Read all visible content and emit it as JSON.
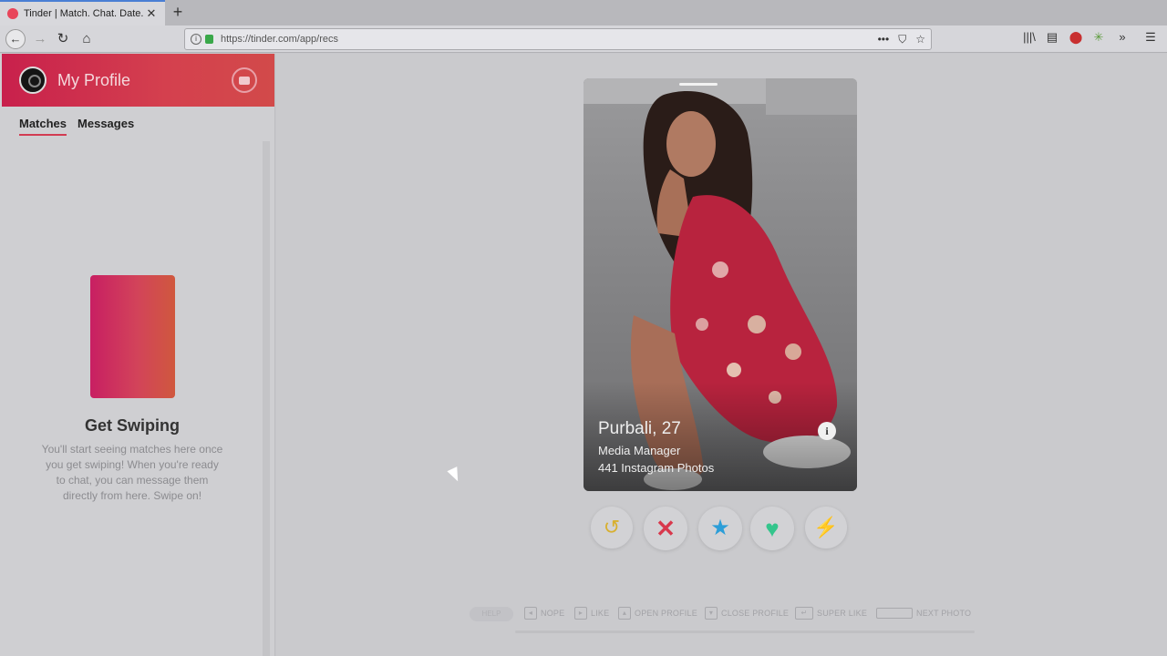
{
  "browser": {
    "tab_title": "Tinder | Match. Chat. Date.",
    "tab_close": "✕",
    "new_tab": "+",
    "url": "https://tinder.com/app/recs",
    "nav": {
      "back": "←",
      "forward": "→",
      "reload": "↻",
      "home": "⌂"
    },
    "url_actions": [
      "•••",
      "⛉",
      "☆"
    ],
    "toolbar_icons": [
      "|||\\",
      "▤",
      "⬤",
      "✳",
      "»",
      "☰"
    ],
    "icon_names": [
      "tinder-favicon",
      "back-icon",
      "forward-icon",
      "reload-icon",
      "home-icon",
      "site-info-icon",
      "lock-icon",
      "page-actions-icon",
      "pocket-icon",
      "bookmark-star-icon",
      "library-icon",
      "sidebar-icon",
      "adblock-icon",
      "extension-icon",
      "overflow-icon",
      "menu-icon"
    ]
  },
  "sidebar": {
    "title": "My Profile",
    "tabs": [
      {
        "label": "Matches",
        "active": true
      },
      {
        "label": "Messages",
        "active": false
      }
    ],
    "empty_title": "Get Swiping",
    "empty_desc": "You'll start seeing matches here once you get swiping! When you're ready to chat, you can message them directly from here. Swipe on!"
  },
  "card": {
    "name_age": "Purbali, 27",
    "job": "Media Manager",
    "instagram": "441 Instagram Photos",
    "info_glyph": "i"
  },
  "actions": {
    "rewind": "↺",
    "nope": "✕",
    "super_like": "★",
    "like": "♥",
    "boost": "⚡"
  },
  "help": {
    "pill": "HELP",
    "items": [
      {
        "key": "◂",
        "label": "NOPE"
      },
      {
        "key": "▸",
        "label": "LIKE"
      },
      {
        "key": "▴",
        "label": "OPEN PROFILE"
      },
      {
        "key": "▾",
        "label": "CLOSE PROFILE"
      },
      {
        "key": "↵",
        "label": "SUPER LIKE"
      },
      {
        "key": "",
        "label": "NEXT PHOTO"
      }
    ]
  },
  "colors": {
    "brand_gradient_start": "#c8204c",
    "brand_gradient_end": "#d24a4a",
    "nope": "#d8384c",
    "super_like": "#2c9ed8",
    "like": "#34c58c",
    "boost": "#8a38c8",
    "rewind": "#d8b030"
  }
}
